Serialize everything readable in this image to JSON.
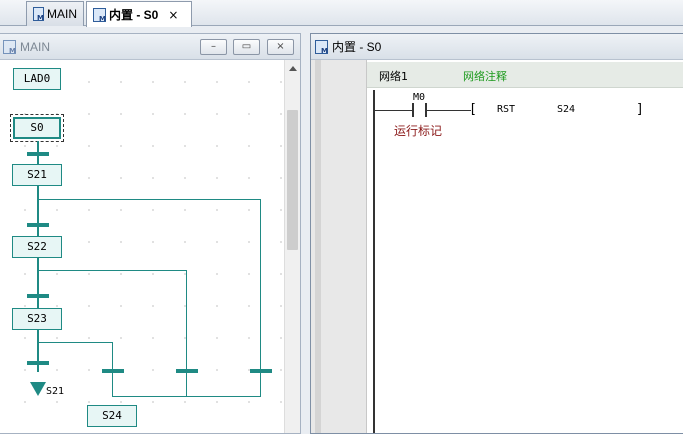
{
  "tabs": [
    {
      "label": "MAIN",
      "active": false,
      "icon": "program-doc-icon"
    },
    {
      "label": "内置 - S0",
      "active": true,
      "icon": "program-doc-icon",
      "close": "×"
    }
  ],
  "left_panel": {
    "title": "MAIN",
    "icon": "program-doc-icon",
    "buttons": {
      "minimize": "–",
      "restore": "▭",
      "close": "×"
    },
    "sfc": {
      "ladder_block": "LAD0",
      "init_step": "S0",
      "steps": [
        "S21",
        "S22",
        "S23"
      ],
      "jump_target": "S21",
      "end_step": "S24"
    }
  },
  "right_panel": {
    "title": "内置 - S0",
    "icon": "program-doc-icon",
    "network": {
      "name": "网络1",
      "comment": "网络注释",
      "contact": "M0",
      "contact_comment": "运行标记",
      "instruction": "RST",
      "operand": "S24",
      "bracket_open": "[",
      "bracket_close": "]"
    }
  },
  "colors": {
    "sfc_line": "#1f8a84",
    "comment_green": "#1c9a1c",
    "contact_comment_red": "#8b1a1a"
  }
}
